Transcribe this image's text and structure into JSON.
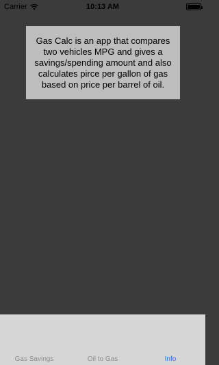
{
  "status_bar": {
    "carrier": "Carrier",
    "time": "10:13 AM",
    "wifi_icon": "wifi-icon",
    "battery_icon": "battery-icon"
  },
  "info_card": {
    "text": "Gas Calc is an app that compares two vehicles MPG and gives a savings/spending amount and also calculates pirce per gallon of gas based on price per barrel of oil."
  },
  "tabs": [
    {
      "label": "Gas Savings",
      "selected": false
    },
    {
      "label": "Oil to Gas",
      "selected": false
    },
    {
      "label": "Info",
      "selected": true
    }
  ],
  "colors": {
    "background": "#3b3b3b",
    "card": "#bdbdbd",
    "tab_bar": "#d6d6d6",
    "tab_inactive": "#8e8e8e",
    "tab_active": "#2b6ee9"
  }
}
